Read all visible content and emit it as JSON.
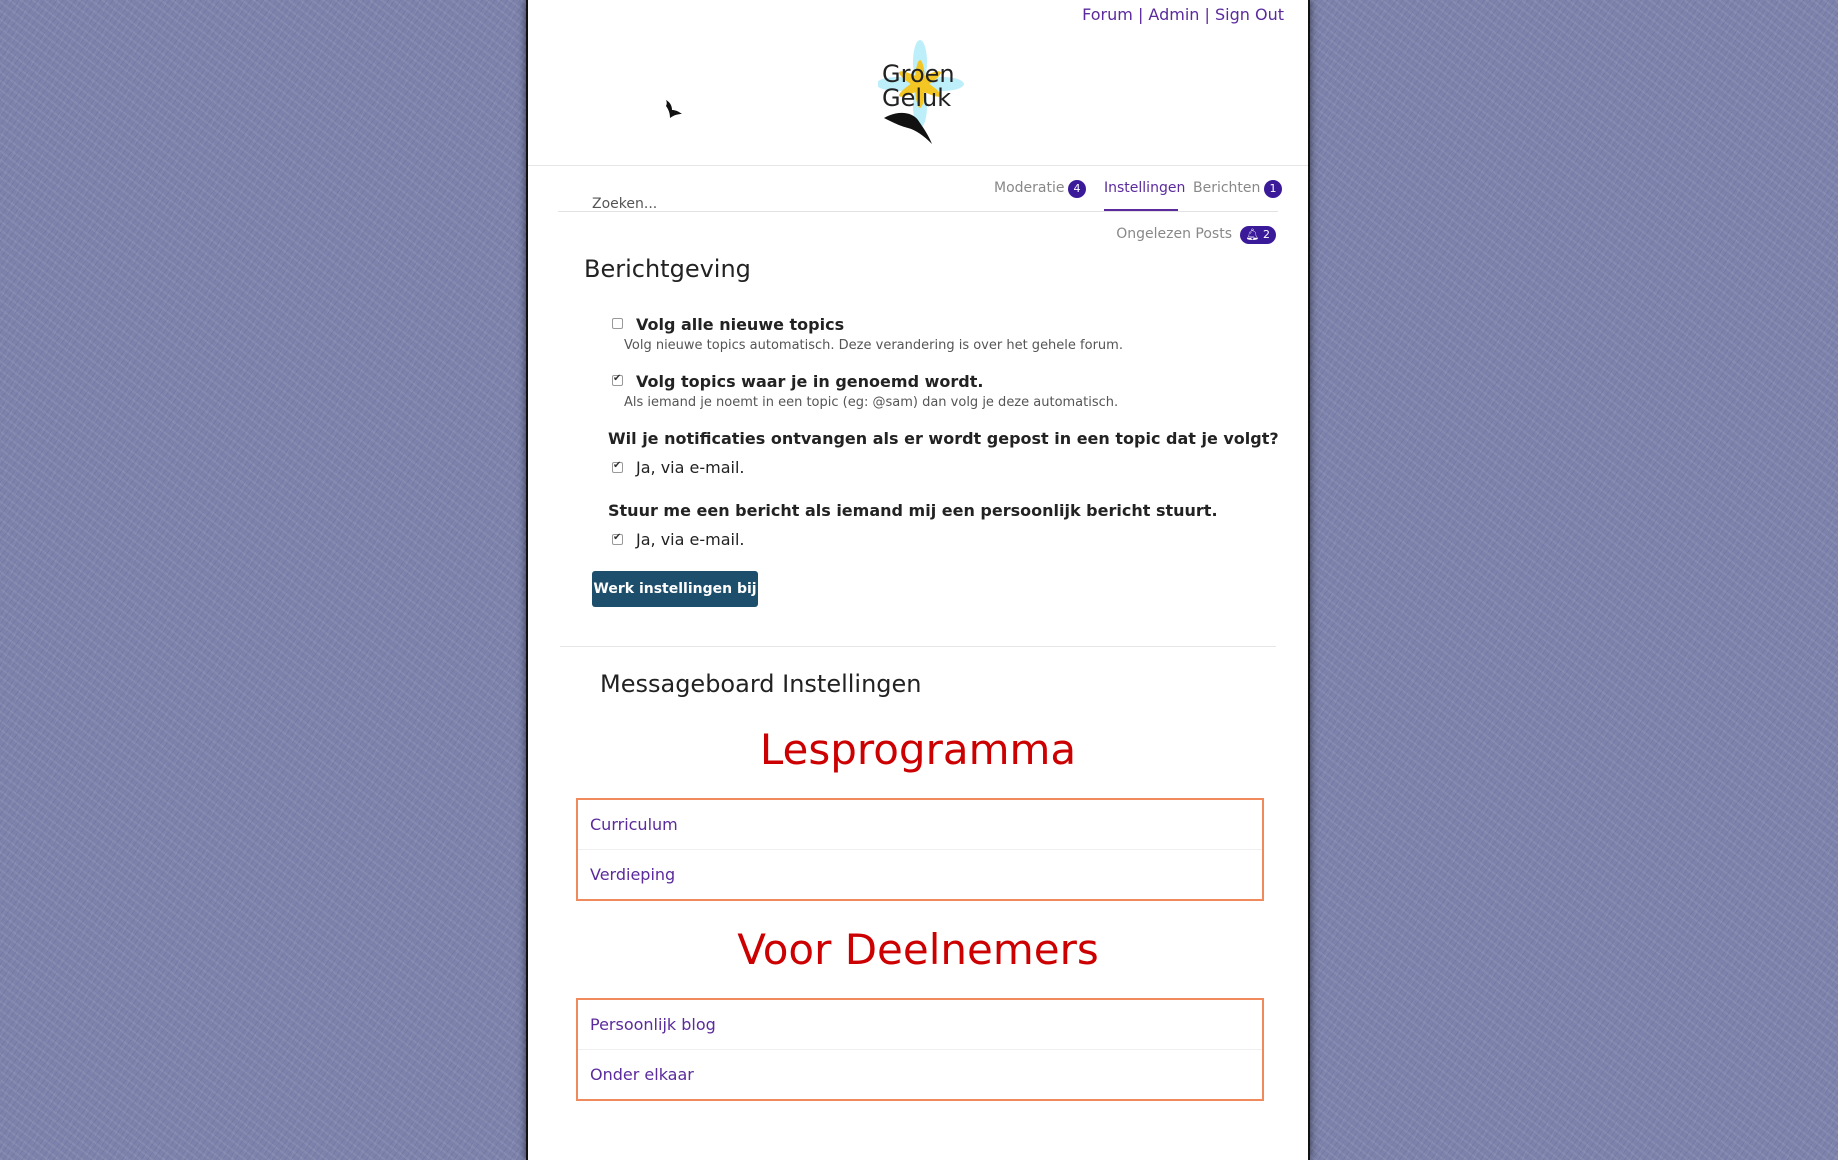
{
  "top_links": {
    "forum": "Forum",
    "separator1": "|",
    "admin": "Admin",
    "separator2": "|",
    "sign_out": "Sign Out"
  },
  "logo": {
    "line1": "Groen",
    "line2": "Geluk"
  },
  "nav": {
    "moderatie": "Moderatie",
    "moderatie_count": "4",
    "instellingen": "Instellingen",
    "berichten": "Berichten",
    "berichten_count": "1"
  },
  "search": {
    "placeholder": "Zoeken..."
  },
  "unread": {
    "label": "Ongelezen Posts",
    "count": "2"
  },
  "notifications": {
    "heading": "Berichtgeving",
    "follow_all": {
      "title": "Volg alle nieuwe topics",
      "desc": "Volg nieuwe topics automatisch. Deze verandering is over het gehele forum.",
      "checked": false
    },
    "follow_mentioned": {
      "title": "Volg topics waar je in genoemd wordt.",
      "desc": "Als iemand je noemt in een topic (eg: @sam) dan volg je deze automatisch.",
      "checked": true
    },
    "q_topic": {
      "title": "Wil je notificaties ontvangen als er wordt gepost in een topic dat je volgt?",
      "option": "Ja, via e-mail.",
      "checked": true
    },
    "q_pm": {
      "title": "Stuur me een bericht als iemand mij een persoonlijk bericht stuurt.",
      "option": "Ja, via e-mail.",
      "checked": true
    },
    "update_button": "Werk instellingen bij"
  },
  "messageboard": {
    "heading": "Messageboard Instellingen",
    "groups": [
      {
        "title": "Lesprogramma",
        "items": [
          "Curriculum",
          "Verdieping"
        ]
      },
      {
        "title": "Voor Deelnemers",
        "items": [
          "Persoonlijk blog",
          "Onder elkaar"
        ]
      }
    ]
  },
  "colors": {
    "accent": "#5b2a9c",
    "badge": "#3b1a99",
    "button": "#1d4e6b",
    "section_title": "#cc0000",
    "box_border": "#f08a5d"
  }
}
